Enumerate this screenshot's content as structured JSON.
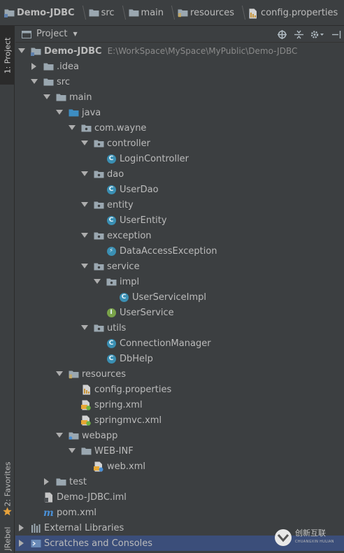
{
  "breadcrumb": [
    {
      "label": "Demo-JDBC",
      "icon": "module-folder-icon"
    },
    {
      "label": "src",
      "icon": "folder-icon"
    },
    {
      "label": "main",
      "icon": "folder-icon"
    },
    {
      "label": "resources",
      "icon": "resources-folder-icon"
    },
    {
      "label": "config.properties",
      "icon": "properties-file-icon"
    }
  ],
  "tool_stripe": {
    "project_tab": "1: Project",
    "favorites_tab": "2: Favorites",
    "jrebel_tab": "JRebel"
  },
  "panel": {
    "title": "Project",
    "tools": [
      "locate-icon",
      "collapse-icon",
      "settings-icon",
      "hide-icon"
    ]
  },
  "tree": [
    {
      "label": "Demo-JDBC",
      "path": "E:\\WorkSpace\\MySpace\\MyPublic\\Demo-JDBC",
      "icon": "module-folder-icon",
      "depth": 0,
      "arrow": "down",
      "bold": true
    },
    {
      "label": ".idea",
      "icon": "folder-icon",
      "depth": 1,
      "arrow": "right"
    },
    {
      "label": "src",
      "icon": "folder-icon",
      "depth": 1,
      "arrow": "down"
    },
    {
      "label": "main",
      "icon": "folder-icon",
      "depth": 2,
      "arrow": "down"
    },
    {
      "label": "java",
      "icon": "source-folder-icon",
      "depth": 3,
      "arrow": "down"
    },
    {
      "label": "com.wayne",
      "icon": "package-icon",
      "depth": 4,
      "arrow": "down"
    },
    {
      "label": "controller",
      "icon": "package-icon",
      "depth": 5,
      "arrow": "down"
    },
    {
      "label": "LoginController",
      "icon": "class-icon",
      "depth": 6,
      "arrow": "none"
    },
    {
      "label": "dao",
      "icon": "package-icon",
      "depth": 5,
      "arrow": "down"
    },
    {
      "label": "UserDao",
      "icon": "class-icon",
      "depth": 6,
      "arrow": "none"
    },
    {
      "label": "entity",
      "icon": "package-icon",
      "depth": 5,
      "arrow": "down"
    },
    {
      "label": "UserEntity",
      "icon": "class-icon",
      "depth": 6,
      "arrow": "none"
    },
    {
      "label": "exception",
      "icon": "package-icon",
      "depth": 5,
      "arrow": "down"
    },
    {
      "label": "DataAccessException",
      "icon": "exception-class-icon",
      "depth": 6,
      "arrow": "none"
    },
    {
      "label": "service",
      "icon": "package-icon",
      "depth": 5,
      "arrow": "down"
    },
    {
      "label": "impl",
      "icon": "package-icon",
      "depth": 6,
      "arrow": "down"
    },
    {
      "label": "UserServiceImpl",
      "icon": "class-icon",
      "depth": 7,
      "arrow": "none"
    },
    {
      "label": "UserService",
      "icon": "interface-icon",
      "depth": 6,
      "arrow": "none"
    },
    {
      "label": "utils",
      "icon": "package-icon",
      "depth": 5,
      "arrow": "down"
    },
    {
      "label": "ConnectionManager",
      "icon": "class-icon",
      "depth": 6,
      "arrow": "none"
    },
    {
      "label": "DbHelp",
      "icon": "class-icon",
      "depth": 6,
      "arrow": "none"
    },
    {
      "label": "resources",
      "icon": "resources-folder-icon",
      "depth": 3,
      "arrow": "down"
    },
    {
      "label": "config.properties",
      "icon": "properties-file-icon",
      "depth": 4,
      "arrow": "none"
    },
    {
      "label": "spring.xml",
      "icon": "spring-xml-icon",
      "depth": 4,
      "arrow": "none"
    },
    {
      "label": "springmvc.xml",
      "icon": "spring-xml-icon",
      "depth": 4,
      "arrow": "none"
    },
    {
      "label": "webapp",
      "icon": "web-folder-icon",
      "depth": 3,
      "arrow": "down"
    },
    {
      "label": "WEB-INF",
      "icon": "folder-icon",
      "depth": 4,
      "arrow": "down"
    },
    {
      "label": "web.xml",
      "icon": "web-xml-icon",
      "depth": 5,
      "arrow": "none"
    },
    {
      "label": "test",
      "icon": "folder-icon",
      "depth": 2,
      "arrow": "right"
    },
    {
      "label": "Demo-JDBC.iml",
      "icon": "iml-file-icon",
      "depth": 1,
      "arrow": "none"
    },
    {
      "label": "pom.xml",
      "icon": "maven-icon",
      "depth": 1,
      "arrow": "none"
    },
    {
      "label": "External Libraries",
      "icon": "libraries-icon",
      "depth": 0,
      "arrow": "right"
    },
    {
      "label": "Scratches and Consoles",
      "icon": "scratches-icon",
      "depth": 0,
      "arrow": "right",
      "selected": true
    }
  ],
  "colors": {
    "background": "#3c3f41",
    "text": "#bbbbbb",
    "selection": "#3b4e7a",
    "class_icon": "#3a8fb3",
    "interface_icon": "#7aa34a"
  },
  "watermark": {
    "text": "创新互联",
    "subtext": "CHUANGXIN HULIAN"
  }
}
